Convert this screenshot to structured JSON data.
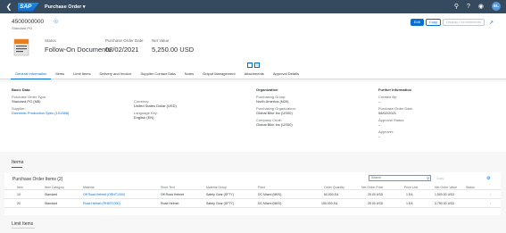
{
  "shell": {
    "back_icon": "chevron-left-icon",
    "logo_text": "SAP",
    "title": "Purchase Order ▾",
    "user_initials": "EL"
  },
  "header": {
    "po_number": "4500000000",
    "po_type": "Standard PO",
    "status_label": "Status",
    "status_value": "Follow-On Documents",
    "date_label": "Purchase Order Date",
    "date_value": "08/02/2021",
    "net_label": "Net Value",
    "net_value": "5,250.00 USD",
    "buttons": {
      "edit": "Edit",
      "copy": "Copy",
      "display_commitments": "Display Commitments"
    }
  },
  "tabs": [
    "General Information",
    "Items",
    "Limit Items",
    "Delivery and Invoice",
    "Supplier Contact Data",
    "Notes",
    "Output Management",
    "Attachments",
    "Approval Details"
  ],
  "general": {
    "basic_heading": "Basic Data",
    "po_type_label": "Purchase Order Type:",
    "po_type_value": "Standard PO (NB)",
    "supplier_label": "Supplier:",
    "supplier_value": "Domestic Production Spec (101388)",
    "currency_label": "Currency:",
    "currency_value": "United States Dollar (USD)",
    "language_label": "Language Key:",
    "language_value": "English (EN)",
    "org_heading": "Organization",
    "pgroup_label": "Purchasing Group:",
    "pgroup_value": "North America (N00)",
    "porg_label": "Purchasing Organization:",
    "porg_value": "Global Bike Inc (US00)",
    "company_label": "Company Code:",
    "company_value": "Global Bike Inc (US00)",
    "further_heading": "Further Information",
    "created_label": "Created By:",
    "created_value": "–",
    "podate_label": "Purchase Order Date:",
    "podate_value": "08/02/2021",
    "approval_label": "Approval Status:",
    "approval_value": "–",
    "approver_label": "Approver:",
    "approver_value": "–"
  },
  "items_section": {
    "title": "Items",
    "table_title": "Purchase Order Items (2)",
    "search_placeholder": "Search",
    "copy_label": "Copy",
    "columns": [
      "Item",
      "Item Category",
      "Material",
      "Short Text",
      "Material Group",
      "Plant",
      "Order Quantity",
      "Net Order Price",
      "Price Unit",
      "Net Order Value",
      "Status"
    ],
    "rows": [
      {
        "item": "10",
        "category": "Standard",
        "material": "Off Road Helmet (ORHT1000)",
        "short_text": "Off Road Helmet",
        "group": "Safety Gear (SFTY)",
        "plant": "DC Miami (MI00)",
        "qty": "60.000  EA",
        "price": "25.00  USD",
        "unit": "1  EA",
        "value": "1,500.00  USD",
        "status": ""
      },
      {
        "item": "20",
        "category": "Standard",
        "material": "Road Helmet (RHMT1000)",
        "short_text": "Road Helmet",
        "group": "Safety Gear (SFTY)",
        "plant": "DC Miami (MI00)",
        "qty": "150.000  EA",
        "price": "25.00  USD",
        "unit": "1  EA",
        "value": "3,750.00  USD",
        "status": ""
      }
    ]
  },
  "limit_section": {
    "title": "Limit Items"
  },
  "colors": {
    "shell": "#354a5f",
    "accent": "#0a6ed1",
    "background": "#f7f7f7"
  }
}
